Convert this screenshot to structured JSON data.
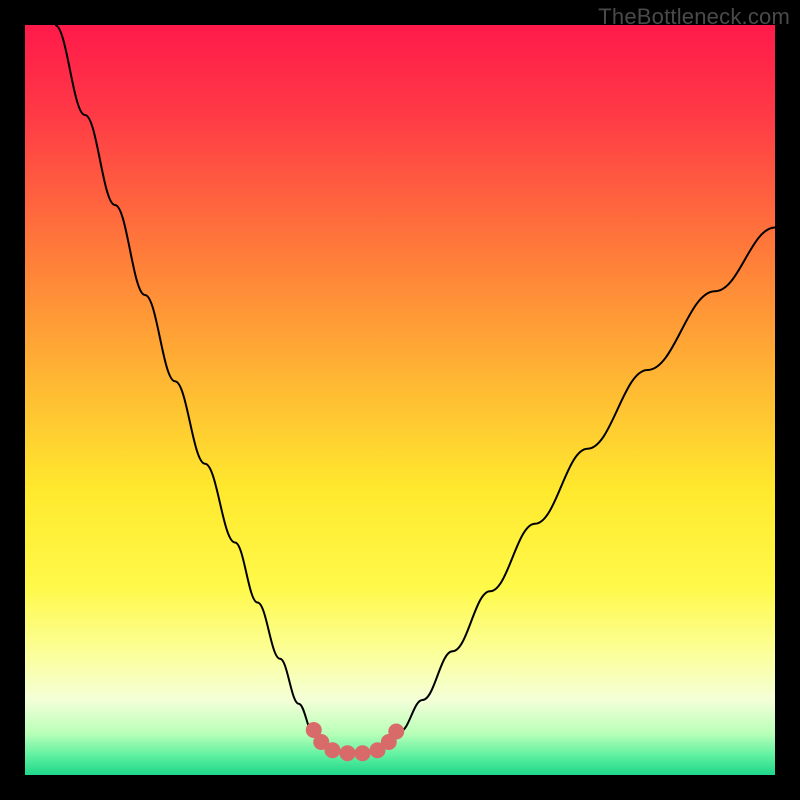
{
  "watermark": "TheBottleneck.com",
  "chart_data": {
    "type": "line",
    "title": "",
    "xlabel": "",
    "ylabel": "",
    "xlim": [
      0,
      100
    ],
    "ylim": [
      0,
      100
    ],
    "grid": false,
    "legend": false,
    "background_gradient": {
      "stops": [
        {
          "offset": 0.0,
          "color": "#ff1a4a"
        },
        {
          "offset": 0.12,
          "color": "#ff3a46"
        },
        {
          "offset": 0.3,
          "color": "#ff7a3a"
        },
        {
          "offset": 0.48,
          "color": "#ffb933"
        },
        {
          "offset": 0.62,
          "color": "#ffe92e"
        },
        {
          "offset": 0.75,
          "color": "#fff94a"
        },
        {
          "offset": 0.84,
          "color": "#fbff9c"
        },
        {
          "offset": 0.9,
          "color": "#f4ffd8"
        },
        {
          "offset": 0.945,
          "color": "#b8ffb8"
        },
        {
          "offset": 0.975,
          "color": "#5cf0a0"
        },
        {
          "offset": 1.0,
          "color": "#1fd68a"
        }
      ]
    },
    "series": [
      {
        "name": "bottleneck-curve",
        "stroke": "#000000",
        "stroke_width": 2,
        "points": [
          {
            "x": 4.0,
            "y": 100.0
          },
          {
            "x": 8.0,
            "y": 88.0
          },
          {
            "x": 12.0,
            "y": 76.0
          },
          {
            "x": 16.0,
            "y": 64.0
          },
          {
            "x": 20.0,
            "y": 52.5
          },
          {
            "x": 24.0,
            "y": 41.5
          },
          {
            "x": 28.0,
            "y": 31.0
          },
          {
            "x": 31.0,
            "y": 23.0
          },
          {
            "x": 34.0,
            "y": 15.5
          },
          {
            "x": 36.5,
            "y": 9.5
          },
          {
            "x": 38.5,
            "y": 5.5
          },
          {
            "x": 40.0,
            "y": 3.8
          },
          {
            "x": 42.0,
            "y": 3.0
          },
          {
            "x": 44.0,
            "y": 2.8
          },
          {
            "x": 46.0,
            "y": 3.0
          },
          {
            "x": 48.0,
            "y": 3.8
          },
          {
            "x": 50.0,
            "y": 5.8
          },
          {
            "x": 53.0,
            "y": 10.0
          },
          {
            "x": 57.0,
            "y": 16.5
          },
          {
            "x": 62.0,
            "y": 24.5
          },
          {
            "x": 68.0,
            "y": 33.5
          },
          {
            "x": 75.0,
            "y": 43.5
          },
          {
            "x": 83.0,
            "y": 54.0
          },
          {
            "x": 92.0,
            "y": 64.5
          },
          {
            "x": 100.0,
            "y": 73.0
          }
        ]
      }
    ],
    "markers": {
      "name": "valley-markers",
      "fill": "#d96a6a",
      "radius": 8,
      "points": [
        {
          "x": 38.5,
          "y": 6.0
        },
        {
          "x": 39.5,
          "y": 4.4
        },
        {
          "x": 41.0,
          "y": 3.3
        },
        {
          "x": 43.0,
          "y": 2.9
        },
        {
          "x": 45.0,
          "y": 2.9
        },
        {
          "x": 47.0,
          "y": 3.3
        },
        {
          "x": 48.5,
          "y": 4.4
        },
        {
          "x": 49.5,
          "y": 5.8
        }
      ]
    }
  }
}
